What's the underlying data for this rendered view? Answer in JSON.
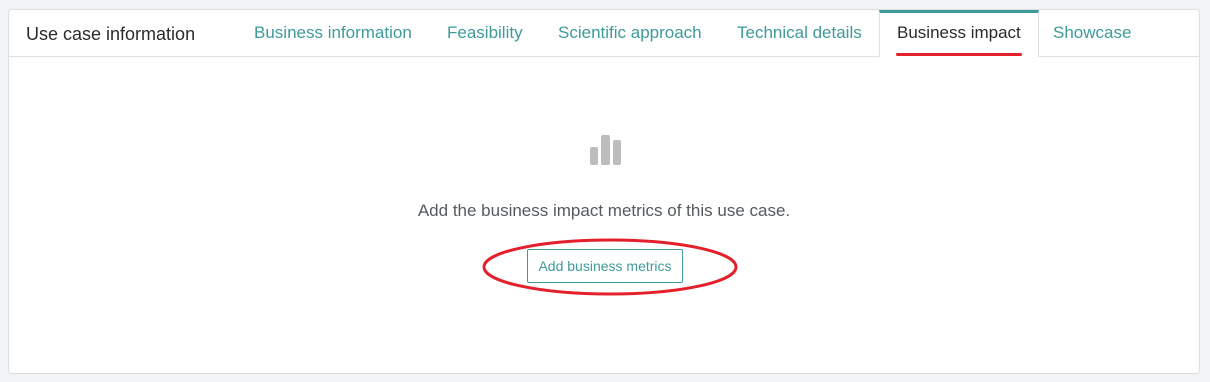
{
  "card": {
    "title": "Use case information"
  },
  "tabs": [
    {
      "label": "Business information",
      "active": false
    },
    {
      "label": "Feasibility",
      "active": false
    },
    {
      "label": "Scientific approach",
      "active": false
    },
    {
      "label": "Technical details",
      "active": false
    },
    {
      "label": "Business impact",
      "active": true
    },
    {
      "label": "Showcase",
      "active": false
    }
  ],
  "empty_state": {
    "icon": "bar-chart-icon",
    "message": "Add the business impact metrics of this use case.",
    "button_label": "Add business metrics"
  },
  "colors": {
    "accent": "#3f9a99",
    "annotation": "#e3202b",
    "icon": "#bdbdbd"
  }
}
